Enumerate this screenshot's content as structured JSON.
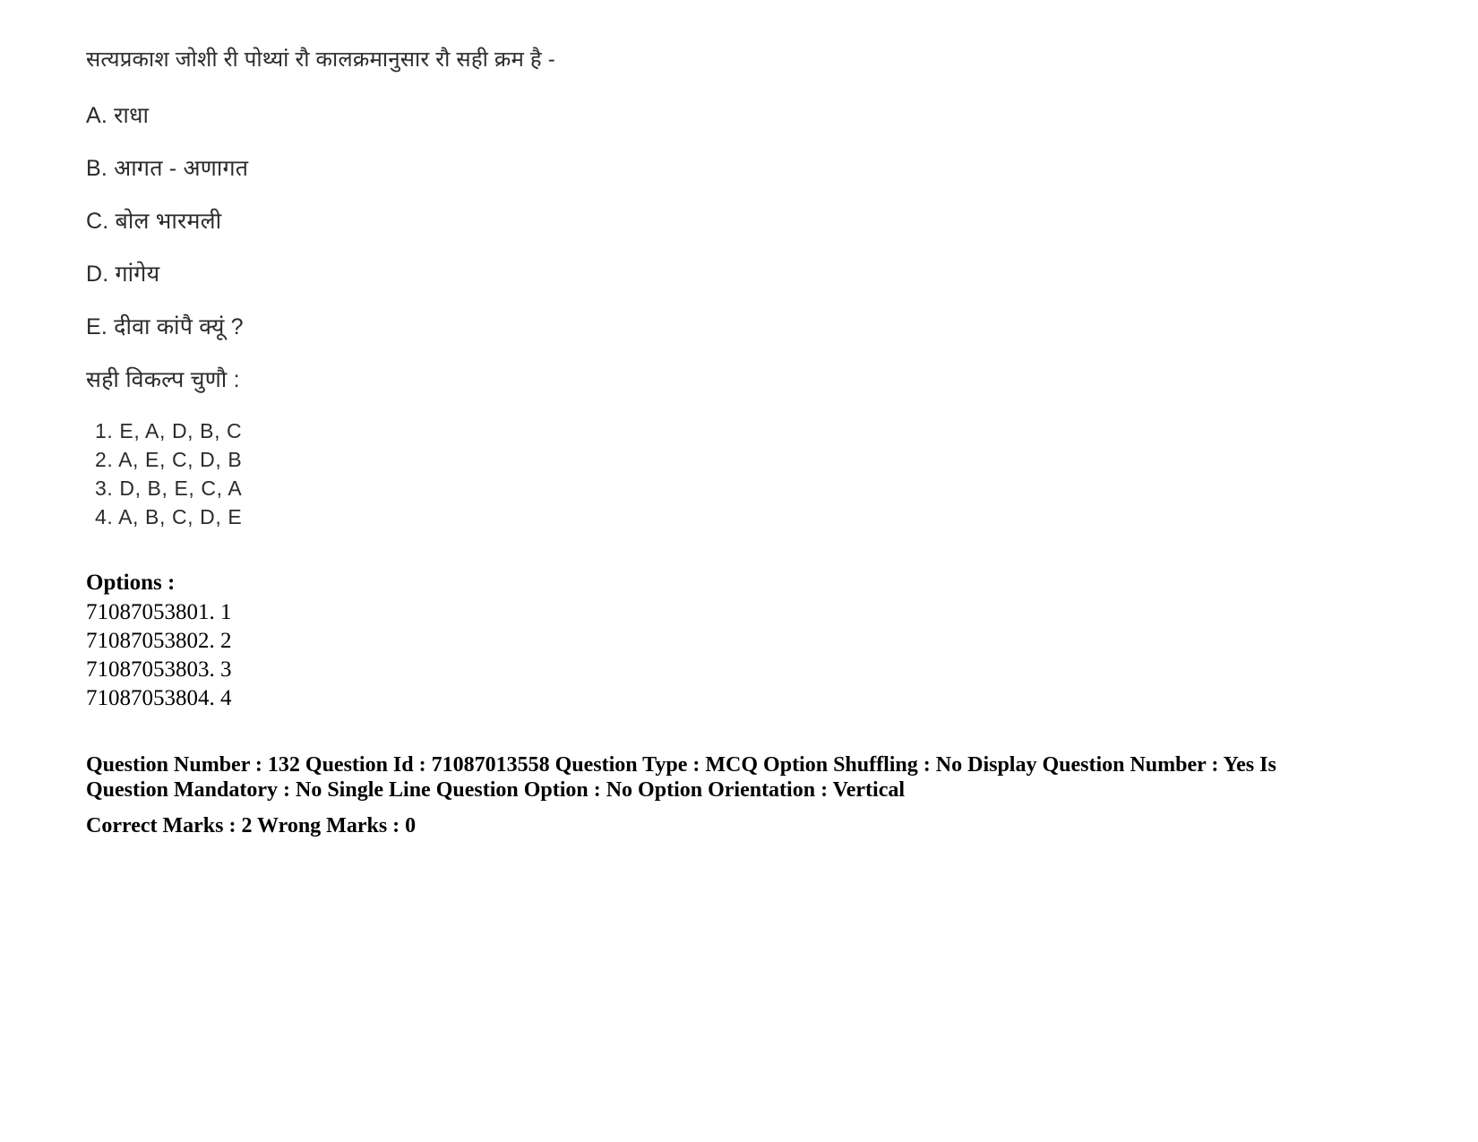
{
  "question": {
    "stem": "सत्यप्रकाश जोशी री पोथ्यां रौ कालक्रमानुसार रौ सही क्रम है -",
    "items": [
      "A. राधा",
      "B. आगत - अणागत",
      "C. बोल भारमली",
      "D. गांगेय",
      "E. दीवा कांपै क्यूं ?"
    ],
    "choose_label": "सही विकल्प चुणौ :",
    "sequences": [
      "1. E, A, D, B, C",
      "2. A, E, C, D, B",
      "3. D, B, E, C, A",
      "4. A, B, C, D, E"
    ]
  },
  "options": {
    "title": "Options :",
    "rows": [
      "71087053801. 1",
      "71087053802. 2",
      "71087053803. 3",
      "71087053804. 4"
    ]
  },
  "metadata": {
    "line1": "Question Number : 132 Question Id : 71087013558 Question Type : MCQ Option Shuffling : No Display Question Number : Yes Is",
    "line2": "Question Mandatory : No Single Line Question Option : No Option Orientation : Vertical",
    "line3": "Correct Marks : 2 Wrong Marks : 0"
  }
}
